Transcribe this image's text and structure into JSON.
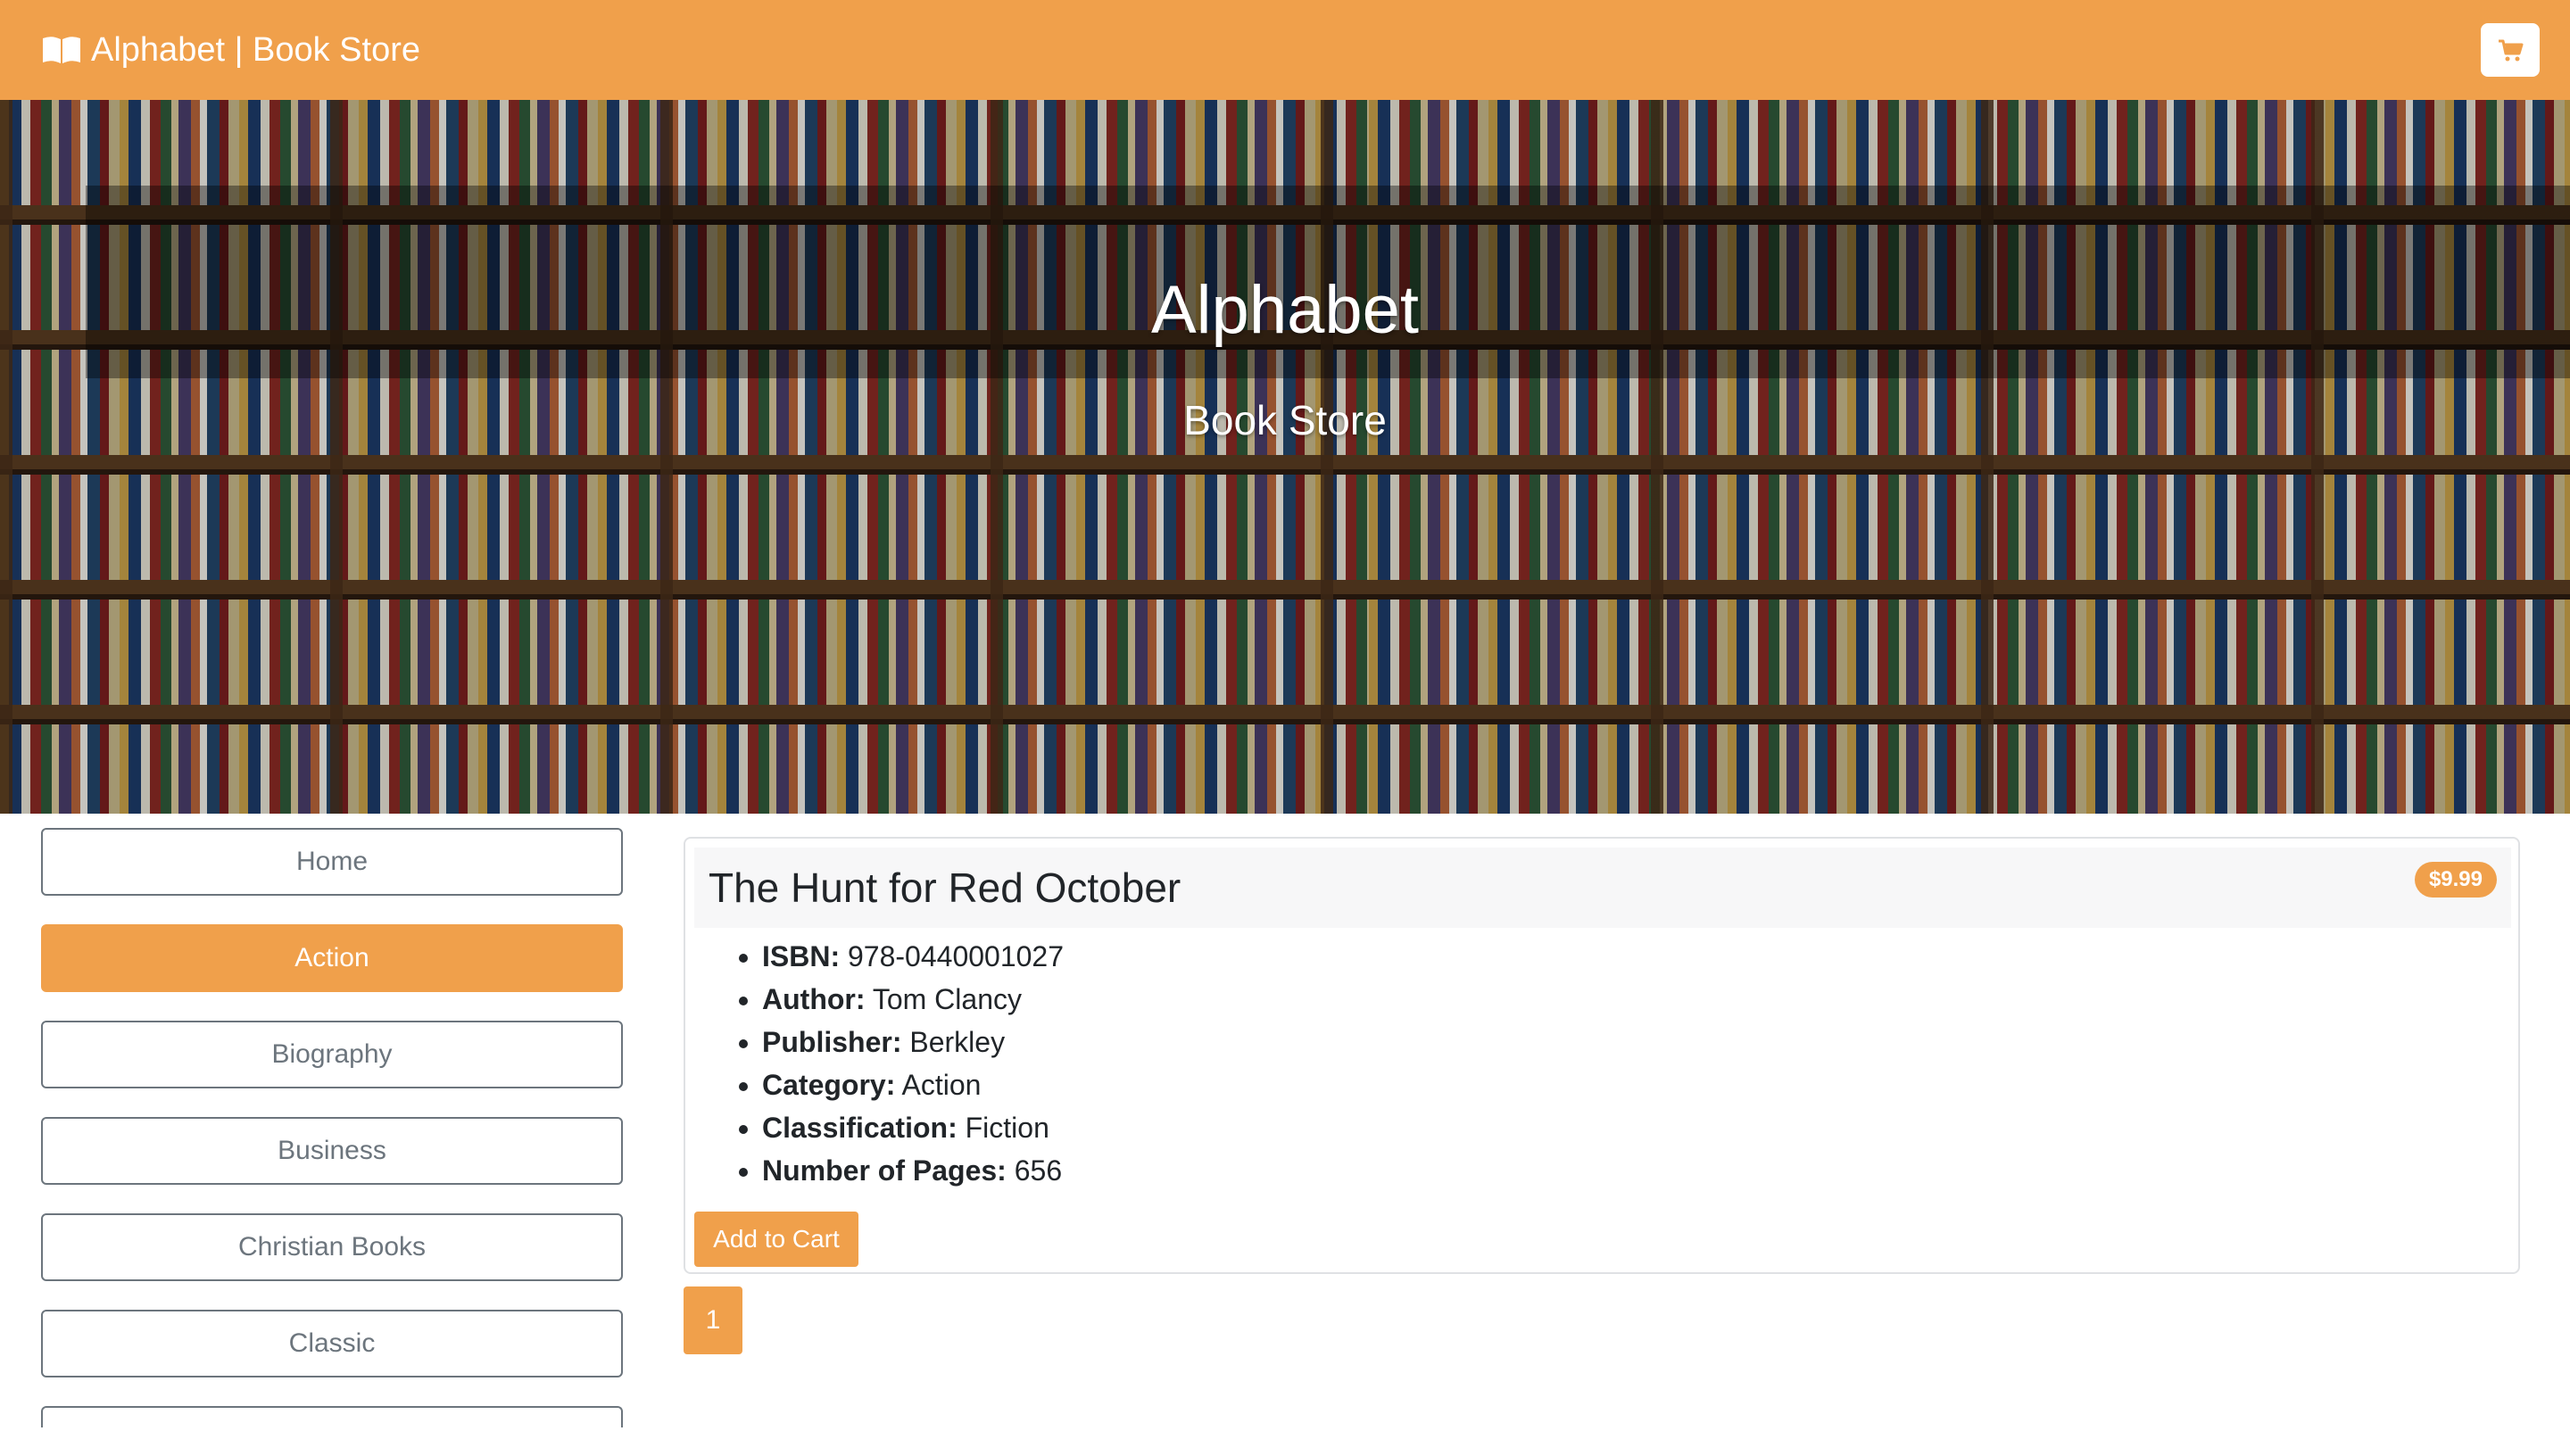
{
  "navbar": {
    "brand": "Alphabet | Book Store",
    "brand_icon": "book-open-icon",
    "cart_icon": "shopping-cart-icon",
    "accent_color": "#f0a04b"
  },
  "hero": {
    "title": "Alphabet",
    "subtitle": "Book Store"
  },
  "sidebar": {
    "items": [
      {
        "label": "Home",
        "active": false
      },
      {
        "label": "Action",
        "active": true
      },
      {
        "label": "Biography",
        "active": false
      },
      {
        "label": "Business",
        "active": false
      },
      {
        "label": "Christian Books",
        "active": false
      },
      {
        "label": "Classic",
        "active": false
      }
    ]
  },
  "book": {
    "title": "The Hunt for Red October",
    "price": "$9.99",
    "details": [
      {
        "label": "ISBN:",
        "value": "978-0440001027"
      },
      {
        "label": "Author:",
        "value": "Tom Clancy"
      },
      {
        "label": "Publisher:",
        "value": "Berkley"
      },
      {
        "label": "Category:",
        "value": "Action"
      },
      {
        "label": "Classification:",
        "value": "Fiction"
      },
      {
        "label": "Number of Pages:",
        "value": "656"
      }
    ],
    "add_to_cart_label": "Add to Cart"
  },
  "pagination": {
    "current_page": "1"
  }
}
